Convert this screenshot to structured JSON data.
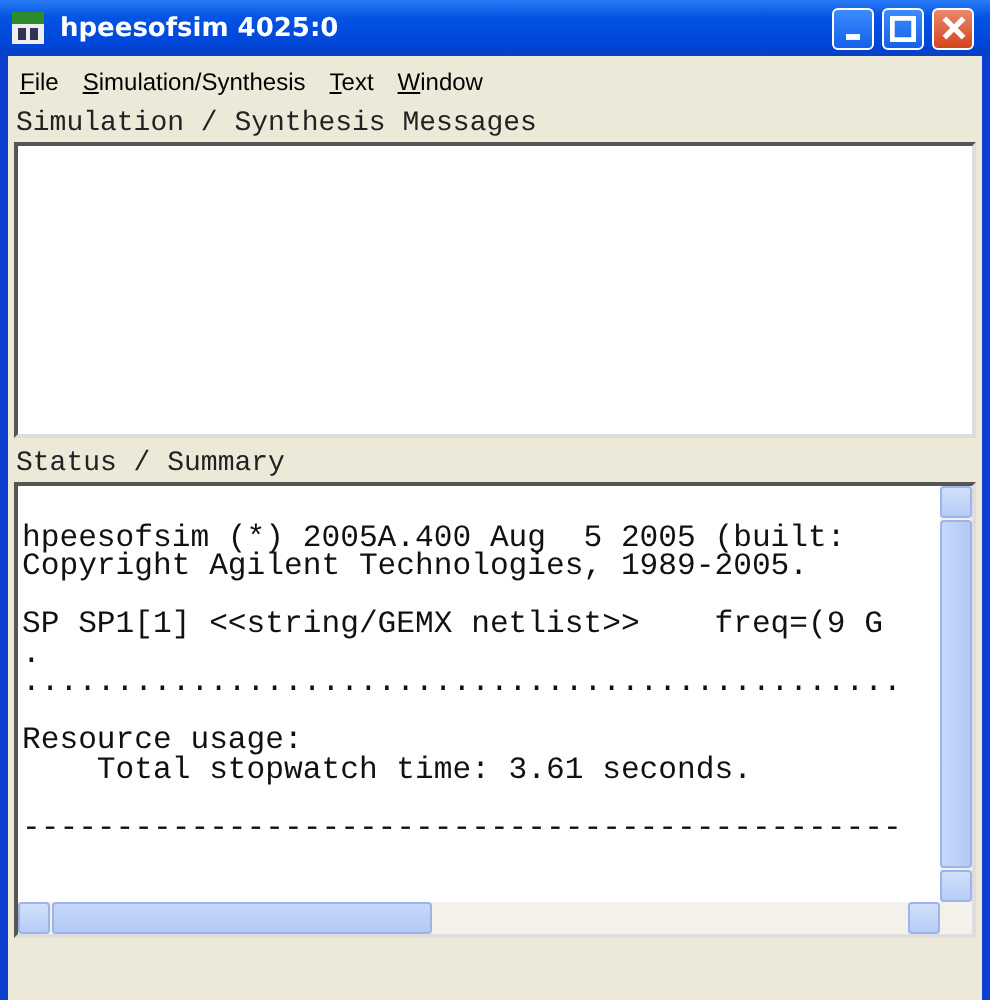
{
  "window": {
    "title": "hpeesofsim 4025:0",
    "controls": [
      {
        "kind": "minimize"
      },
      {
        "kind": "maximize"
      },
      {
        "kind": "close"
      }
    ]
  },
  "menu": [
    {
      "label": "File",
      "underline_first": true
    },
    {
      "label": "Simulation/Synthesis",
      "underline_first": true
    },
    {
      "label": "Text",
      "underline_first": true
    },
    {
      "label": "Window",
      "underline_first": true
    }
  ],
  "panels": [
    {
      "title": "Simulation / Synthesis Messages"
    },
    {
      "title": "Status / Summary",
      "paragraphs": [
        [
          "hpeesofsim (*) 2005A.400 Aug  5 2005 (built:",
          "Copyright Agilent Technologies, 1989-2005."
        ],
        [
          "SP SP1[1] <<string/GEMX netlist>>    freq=(9 G",
          ".",
          "..............................................."
        ],
        [
          "Resource usage:",
          "    Total stopwatch time: 3.61 seconds."
        ],
        [
          "-----------------------------------------------"
        ]
      ]
    }
  ]
}
